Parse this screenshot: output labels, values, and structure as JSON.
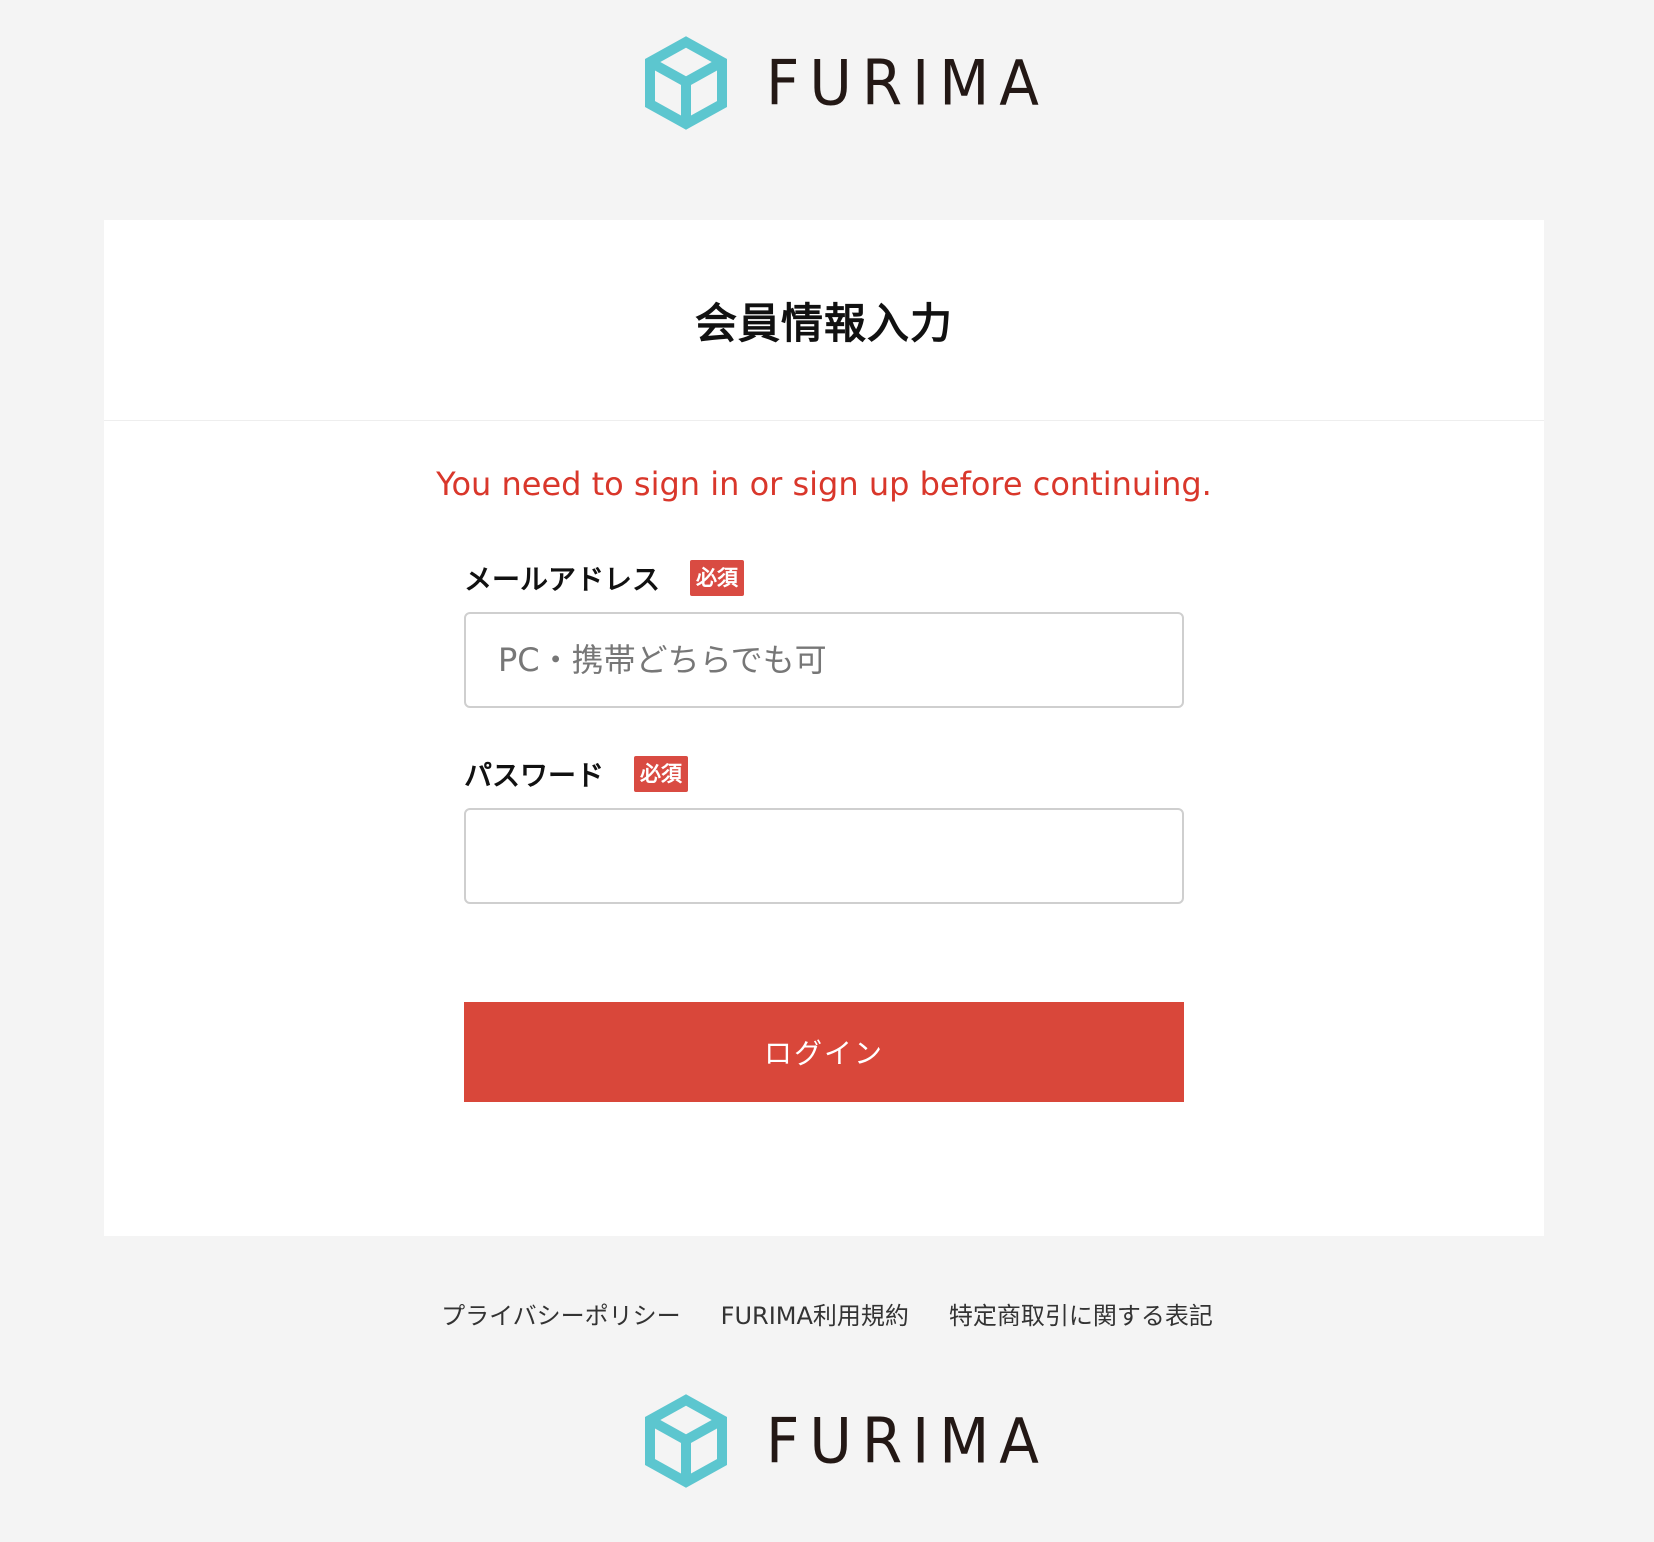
{
  "brand": {
    "name": "FURIMA",
    "logo_color": "#5cc6cf",
    "text_color": "#231815"
  },
  "page": {
    "title": "会員情報入力",
    "alert": "You need to sign in or sign up before continuing."
  },
  "form": {
    "email": {
      "label": "メールアドレス",
      "required_badge": "必須",
      "placeholder": "PC・携帯どちらでも可",
      "value": ""
    },
    "password": {
      "label": "パスワード",
      "required_badge": "必須",
      "placeholder": "",
      "value": ""
    },
    "submit_label": "ログイン"
  },
  "footer": {
    "links": [
      "プライバシーポリシー",
      "FURIMA利用規約",
      "特定商取引に関する表記"
    ]
  },
  "colors": {
    "background": "#f4f4f4",
    "card": "#ffffff",
    "alert": "#d9372b",
    "button": "#d9473a",
    "badge": "#d94b42"
  }
}
